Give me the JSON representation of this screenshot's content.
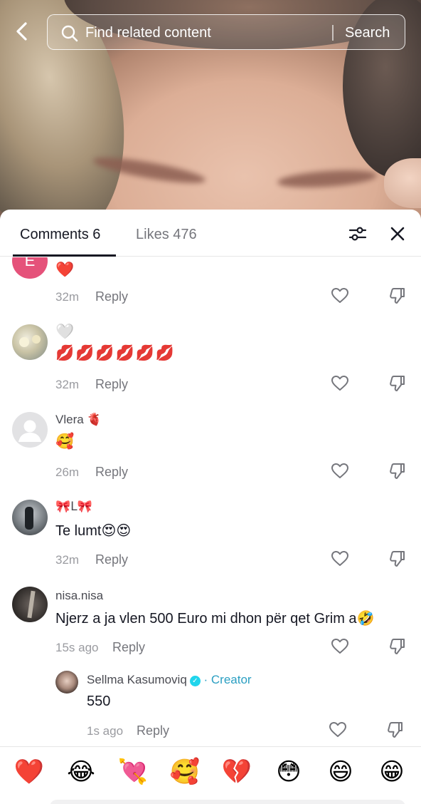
{
  "search": {
    "placeholder": "Find related content",
    "button_label": "Search"
  },
  "tabs": [
    {
      "label": "Comments 6",
      "active": true
    },
    {
      "label": "Likes 476",
      "active": false
    }
  ],
  "comments": [
    {
      "avatar_letter": "E",
      "username": "",
      "text": "❤️",
      "time": "32m",
      "reply": "Reply"
    },
    {
      "avatar_letter": "",
      "username": "🤍",
      "text": "💋💋💋💋💋💋",
      "time": "32m",
      "reply": "Reply"
    },
    {
      "avatar_letter": "",
      "username": "Vlera 🫀",
      "text": "🥰",
      "time": "26m",
      "reply": "Reply"
    },
    {
      "avatar_letter": "",
      "username": "🎀L🎀",
      "text": "Te lumt😍😍",
      "time": "32m",
      "reply": "Reply"
    },
    {
      "avatar_letter": "",
      "username": "nisa.nisa",
      "text": "Njerz a ja vlen 500 Euro mi dhon për qet Grim a🤣",
      "time": "15s ago",
      "reply": "Reply"
    }
  ],
  "reply": {
    "username": "Sellma Kasumoviq",
    "badge": "✓",
    "creator_tag": "· Creator",
    "text": "550",
    "time": "1s ago",
    "reply": "Reply"
  },
  "emoji_bar": [
    "❤️",
    "😂",
    "💘",
    "🥰",
    "💔",
    "😳",
    "😄",
    "😁"
  ],
  "colors": {
    "text_primary": "#161823",
    "text_secondary": "#75767c",
    "avatar_e": "#e5527a",
    "creator_blue": "#2b9fc2"
  }
}
